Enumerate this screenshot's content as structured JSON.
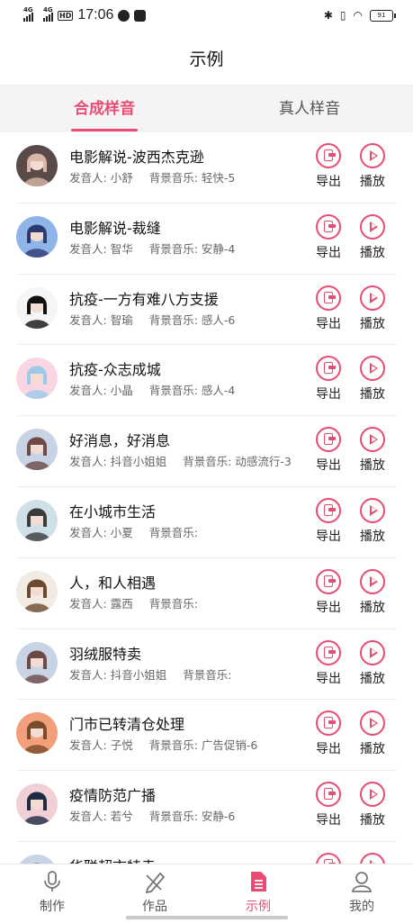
{
  "status_bar": {
    "sim1": "4G",
    "sim2": "4G",
    "hd": "HD",
    "time": "17:06",
    "battery": "91"
  },
  "header": {
    "title": "示例"
  },
  "tabs": [
    {
      "label": "合成样音",
      "active": true
    },
    {
      "label": "真人样音",
      "active": false
    }
  ],
  "list_labels": {
    "speaker_prefix": "发音人:",
    "music_prefix": "背景音乐:",
    "export": "导出",
    "play": "播放"
  },
  "items": [
    {
      "title": "电影解说-波西杰克逊",
      "speaker": "小舒",
      "music": "轻快-5",
      "avatar_bg": "#5a4a4a",
      "avatar_fg": "#d9b6a6"
    },
    {
      "title": "电影解说-裁缝",
      "speaker": "智华",
      "music": "安静-4",
      "avatar_bg": "#8fb4e8",
      "avatar_fg": "#2c3a6e"
    },
    {
      "title": "抗疫-一方有难八方支援",
      "speaker": "智瑜",
      "music": "感人-6",
      "avatar_bg": "#f5f5f5",
      "avatar_fg": "#111111"
    },
    {
      "title": "抗疫-众志成城",
      "speaker": "小晶",
      "music": "感人-4",
      "avatar_bg": "#f8d7e3",
      "avatar_fg": "#9cc9ea"
    },
    {
      "title": "好消息，好消息",
      "speaker": "抖音小姐姐",
      "music": "动感流行-3",
      "avatar_bg": "#c8d3e6",
      "avatar_fg": "#6e4a46"
    },
    {
      "title": "在小城市生活",
      "speaker": "小夏",
      "music": "",
      "avatar_bg": "#cfe0e8",
      "avatar_fg": "#3b3b3b"
    },
    {
      "title": "人，和人相遇",
      "speaker": "露西",
      "music": "",
      "avatar_bg": "#f2ebe3",
      "avatar_fg": "#6b4a30"
    },
    {
      "title": "羽绒服特卖",
      "speaker": "抖音小姐姐",
      "music": "",
      "avatar_bg": "#c8d3e6",
      "avatar_fg": "#6e4a46"
    },
    {
      "title": "门市已转清仓处理",
      "speaker": "子悦",
      "music": "广告促销-6",
      "avatar_bg": "#f2a07b",
      "avatar_fg": "#7a4a2a"
    },
    {
      "title": "疫情防范广播",
      "speaker": "若兮",
      "music": "安静-6",
      "avatar_bg": "#f0d0d6",
      "avatar_fg": "#1f2a44"
    },
    {
      "title": "华联超市特卖",
      "speaker": "",
      "music": "",
      "avatar_bg": "#c8d3e6",
      "avatar_fg": "#6e4a46"
    }
  ],
  "bottom_nav": [
    {
      "label": "制作",
      "icon": "microphone-icon",
      "active": false
    },
    {
      "label": "作品",
      "icon": "works-pencil-icon",
      "active": false
    },
    {
      "label": "示例",
      "icon": "document-list-icon",
      "active": true
    },
    {
      "label": "我的",
      "icon": "user-profile-icon",
      "active": false
    }
  ],
  "colors": {
    "accent": "#e94c72"
  }
}
